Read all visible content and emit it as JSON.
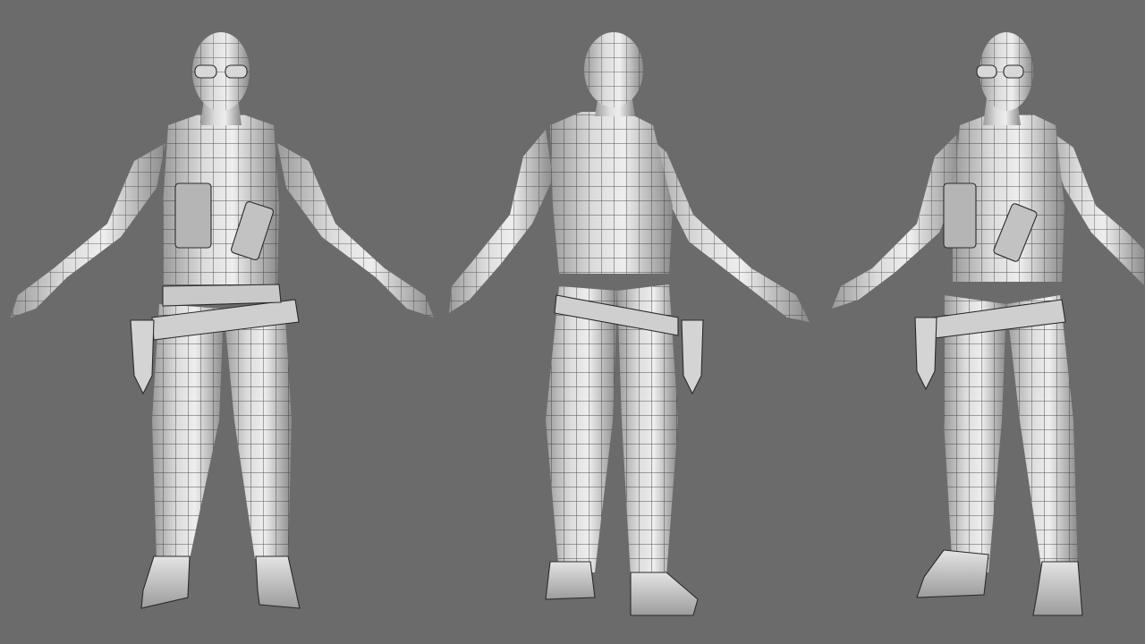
{
  "scene": {
    "background_color": "#6b6b6b",
    "model_color_light": "#e6e6e6",
    "model_color_dark": "#8e8e8e",
    "wireframe_color": "#2b2b2b"
  },
  "views": [
    {
      "name": "front"
    },
    {
      "name": "back"
    },
    {
      "name": "three-quarter"
    }
  ]
}
